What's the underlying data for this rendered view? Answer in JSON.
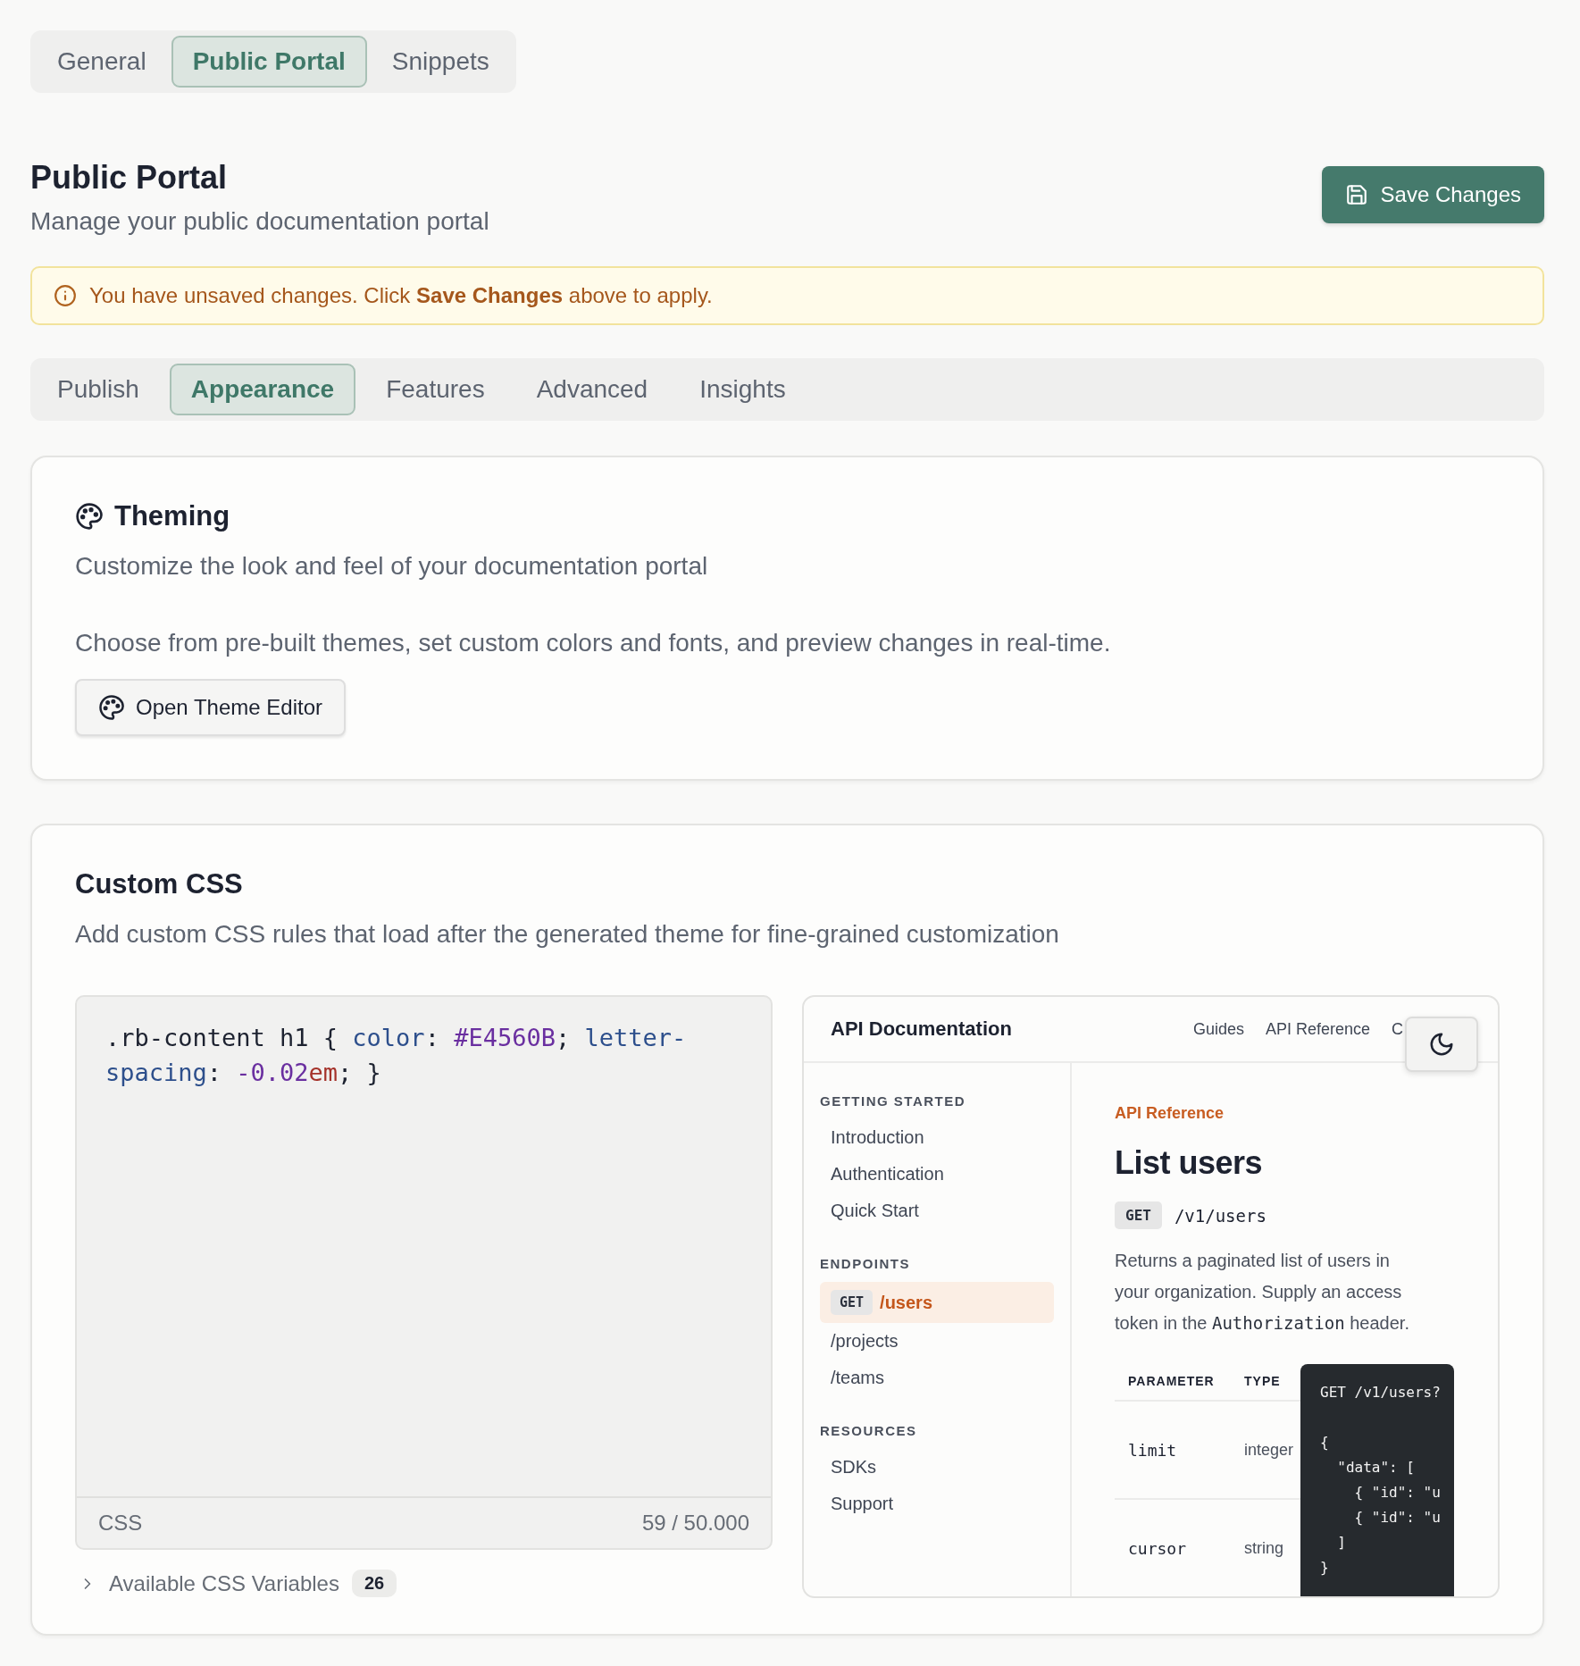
{
  "top_tabs": [
    {
      "label": "General",
      "selected": false
    },
    {
      "label": "Public Portal",
      "selected": true
    },
    {
      "label": "Snippets",
      "selected": false
    }
  ],
  "header": {
    "title": "Public Portal",
    "subtitle": "Manage your public documentation portal",
    "save_button": "Save Changes"
  },
  "alert": {
    "text": "You have unsaved changes. Click **Save Changes** above to apply."
  },
  "section_tabs": [
    {
      "label": "Publish",
      "selected": false
    },
    {
      "label": "Appearance",
      "selected": true
    },
    {
      "label": "Features",
      "selected": false
    },
    {
      "label": "Advanced",
      "selected": false
    },
    {
      "label": "Insights",
      "selected": false
    }
  ],
  "theming": {
    "title": "Theming",
    "description": "Customize the look and feel of your documentation portal",
    "body": "Choose from pre-built themes, set custom colors and fonts, and preview changes in real-time.",
    "button": "Open Theme Editor"
  },
  "custom_css": {
    "title": "Custom CSS",
    "description": "Add custom CSS rules that load after the generated theme for fine-grained customization",
    "editor": {
      "tokens": [
        {
          "text": ".rb-content h1 { ",
          "kind": "plain"
        },
        {
          "text": "color",
          "kind": "property"
        },
        {
          "text": ": ",
          "kind": "plain"
        },
        {
          "text": "#E4560B",
          "kind": "value"
        },
        {
          "text": "; ",
          "kind": "plain"
        },
        {
          "text": "letter-spacing",
          "kind": "property"
        },
        {
          "text": ": ",
          "kind": "plain"
        },
        {
          "text": "-0.02",
          "kind": "value"
        },
        {
          "text": "em",
          "kind": "unit"
        },
        {
          "text": "; }",
          "kind": "plain"
        }
      ],
      "language": "CSS",
      "count": "59 / 50.000"
    },
    "variables": {
      "label": "Available CSS Variables",
      "count": "26",
      "expanded": false
    },
    "preview": {
      "site_title": "API Documentation",
      "nav": [
        "Guides",
        "API Reference",
        "C"
      ],
      "sidebar": [
        {
          "title": "GETTING STARTED",
          "items": [
            {
              "label": "Introduction",
              "selected": false
            },
            {
              "label": "Authentication",
              "selected": false
            },
            {
              "label": "Quick Start",
              "selected": false
            }
          ]
        },
        {
          "title": "ENDPOINTS",
          "items": [
            {
              "method": "GET",
              "label": "/users",
              "selected": true
            },
            {
              "label": "/projects",
              "selected": false
            },
            {
              "label": "/teams",
              "selected": false
            }
          ]
        },
        {
          "title": "RESOURCES",
          "items": [
            {
              "label": "SDKs",
              "selected": false
            },
            {
              "label": "Support",
              "selected": false
            }
          ]
        }
      ],
      "breadcrumb": "API Reference",
      "heading": "List users",
      "method": "GET",
      "path": "/v1/users",
      "description": [
        {
          "text": "Returns a paginated list of users in your organization. Supply an access token in the ",
          "kind": "text"
        },
        {
          "text": "Authorization",
          "kind": "code"
        },
        {
          "text": " header.",
          "kind": "text"
        }
      ],
      "table": {
        "columns": [
          "PARAMETER",
          "TYPE"
        ],
        "rows": [
          [
            "limit",
            "integer"
          ],
          [
            "cursor",
            "string"
          ]
        ]
      },
      "code_groups": [
        [
          "GET /v1/users?"
        ],
        [
          "{",
          "  \"data\": [",
          "    { \"id\": \"u",
          "    { \"id\": \"u",
          "  ]",
          "}"
        ]
      ]
    }
  }
}
